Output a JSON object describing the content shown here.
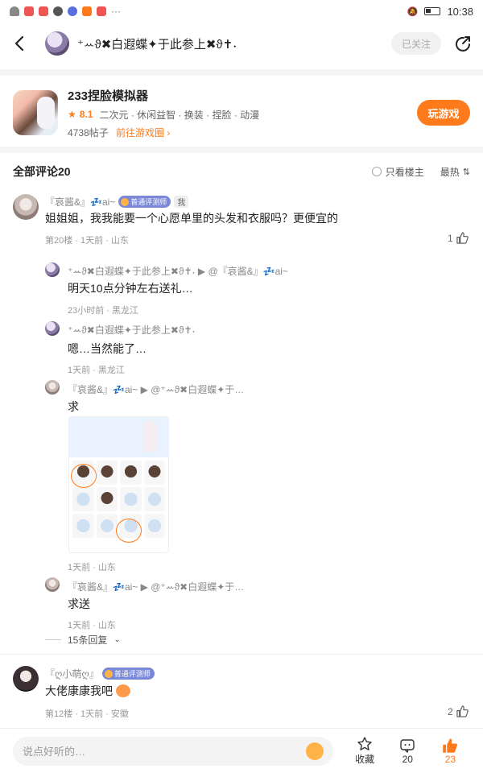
{
  "status": {
    "time": "10:38"
  },
  "header": {
    "name": "⁺ꕀϑ✖白遐蝶✦于此参上✖ϑ✝˖",
    "follow_label": "已关注"
  },
  "game": {
    "title": "233捏脸模拟器",
    "rating": "8.1",
    "tags": "二次元 · 休闲益智 · 换装 · 捏脸 · 动漫",
    "posts": "4738帖子",
    "goto": "前往游戏圈",
    "play": "玩游戏"
  },
  "comments_header": {
    "title": "全部评论20",
    "only_op": "只看楼主",
    "sort": "最热"
  },
  "badge_label": "普通评测师",
  "me_label": "我",
  "comments": [
    {
      "user": "『哀酱&』💤ai~",
      "text": "姐姐姐，我我能要一个心愿单里的头发和衣服吗？更便宜的",
      "meta": "第20楼 · 1天前 · 山东",
      "likes": "1"
    },
    {
      "user": "『ღ小萌ღ』",
      "text": "大佬康康我吧",
      "meta": "第12楼 · 1天前 · 安徽",
      "likes": "2"
    }
  ],
  "replies": [
    {
      "user": "⁺ꕀϑ✖白遐蝶✦于此参上✖ϑ✝˖ ▶ @『哀酱&』💤ai~",
      "text": "明天10点分钟左右送礼…",
      "meta": "23小时前 · 黑龙江"
    },
    {
      "user": "⁺ꕀϑ✖白遐蝶✦于此参上✖ϑ✝˖",
      "text": "嗯…当然能了…",
      "meta": "1天前 · 黑龙江"
    },
    {
      "user": "『哀酱&』💤ai~ ▶ @⁺ꕀϑ✖白遐蝶✦于…",
      "text": "求",
      "meta": "1天前 · 山东"
    },
    {
      "user": "『哀酱&』💤ai~ ▶ @⁺ꕀϑ✖白遐蝶✦于…",
      "text": "求送",
      "meta": "1天前 · 山东"
    }
  ],
  "more_replies": "15条回复",
  "bottom": {
    "placeholder": "说点好听的…",
    "collect_label": "收藏",
    "comment_count": "20",
    "like_count": "23"
  },
  "colors": {
    "accent": "#ff7a1a",
    "badge": "#7a88d8"
  }
}
